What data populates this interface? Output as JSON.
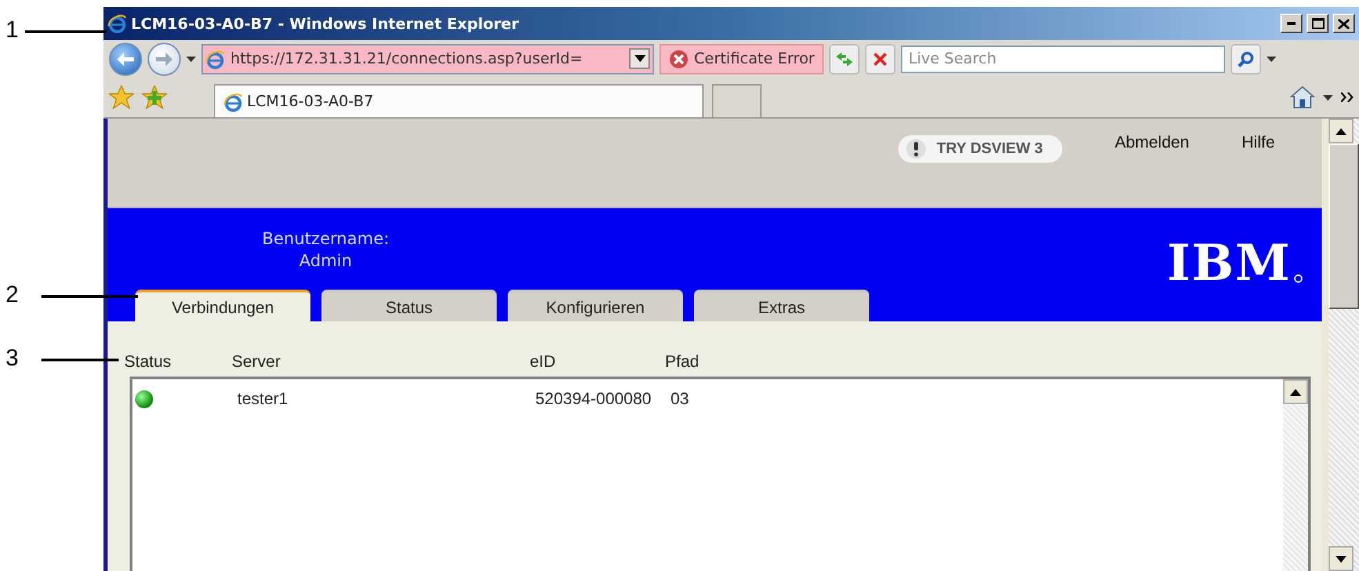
{
  "callouts": [
    "1",
    "2",
    "3"
  ],
  "window": {
    "title": "LCM16-03-A0-B7 - Windows Internet Explorer"
  },
  "toolbar": {
    "address": "https://172.31.31.21/connections.asp?userId=",
    "certificate_error": "Certificate Error",
    "search": {
      "placeholder": "Live Search"
    }
  },
  "browser_tabs": [
    {
      "label": "LCM16-03-A0-B7",
      "selected": true
    }
  ],
  "page": {
    "try_button": "TRY DSVIEW 3",
    "links": [
      "Abmelden",
      "Hilfe"
    ],
    "user_label": "Benutzername:",
    "user_name": "Admin",
    "logo": "IBM",
    "tabs": [
      {
        "label": "Verbindungen",
        "selected": true
      },
      {
        "label": "Status",
        "selected": false
      },
      {
        "label": "Konfigurieren",
        "selected": false
      },
      {
        "label": "Extras",
        "selected": false
      }
    ],
    "table": {
      "columns": [
        "Status",
        "Server",
        "eID",
        "Pfad"
      ],
      "rows": [
        {
          "online": true,
          "server": "tester1",
          "eid": "520394-000080",
          "pfad": "03"
        }
      ]
    }
  }
}
